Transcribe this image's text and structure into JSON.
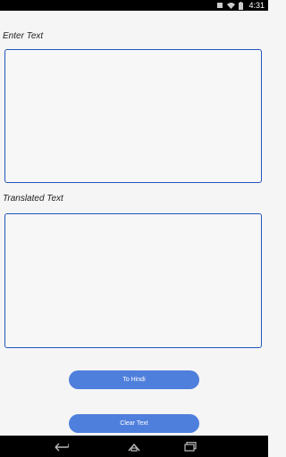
{
  "status_bar": {
    "time": "4:31",
    "icons": [
      "notification-icon",
      "wifi-icon",
      "battery-icon"
    ]
  },
  "labels": {
    "enter_text": "Enter Text",
    "translated_text": "Translated Text"
  },
  "inputs": {
    "enter_text_value": "",
    "translated_text_value": ""
  },
  "buttons": {
    "to_hindi": "To Hindi",
    "clear_text": "Clear Text"
  },
  "nav_bar": {
    "icons": [
      "back-icon",
      "home-icon",
      "recent-apps-icon"
    ]
  },
  "colors": {
    "accent": "#4f7fdc",
    "border": "#2255bb",
    "background": "#f5f5f5"
  }
}
